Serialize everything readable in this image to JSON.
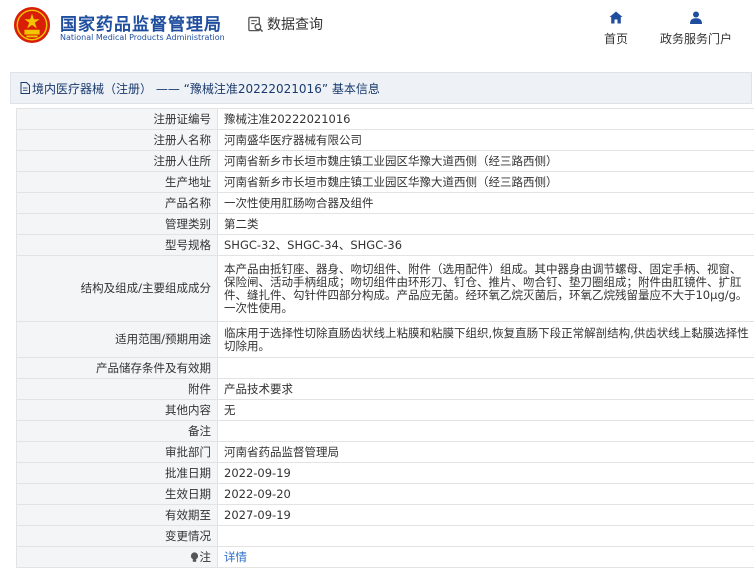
{
  "header": {
    "brand_cn": "国家药品监督管理局",
    "brand_en": "National Medical Products Administration",
    "query_label": "数据查询",
    "nav": [
      {
        "label": "首页",
        "icon": "home-icon"
      },
      {
        "label": "政务服务门户",
        "icon": "user-icon"
      }
    ]
  },
  "page": {
    "title": "境内医疗器械（注册） —— “豫械注准20222021016” 基本信息"
  },
  "rows": [
    {
      "label": "注册证编号",
      "value": "豫械注准20222021016"
    },
    {
      "label": "注册人名称",
      "value": "河南盛华医疗器械有限公司"
    },
    {
      "label": "注册人住所",
      "value": "河南省新乡市长垣市魏庄镇工业园区华豫大道西侧（经三路西侧）"
    },
    {
      "label": "生产地址",
      "value": "河南省新乡市长垣市魏庄镇工业园区华豫大道西侧（经三路西侧）"
    },
    {
      "label": "产品名称",
      "value": "一次性使用肛肠吻合器及组件"
    },
    {
      "label": "管理类别",
      "value": "第二类"
    },
    {
      "label": "型号规格",
      "value": "SHGC-32、SHGC-34、SHGC-36"
    },
    {
      "label": "结构及组成/主要组成成分",
      "value": "本产品由抵钉座、器身、吻切组件、附件（选用配件）组成。其中器身由调节螺母、固定手柄、视窗、保险闸、活动手柄组成；吻切组件由环形刀、钉仓、推片、吻合钉、垫刀圈组成；附件由肛镜件、扩肛件、缝扎件、勾针件四部分构成。产品应无菌。经环氧乙烷灭菌后，环氧乙烷残留量应不大于10μg/g。一次性使用。"
    },
    {
      "label": "适用范围/预期用途",
      "value": "临床用于选择性切除直肠齿状线上粘膜和粘膜下组织,恢复直肠下段正常解剖结构,供齿状线上黏膜选择性切除用。"
    },
    {
      "label": "产品储存条件及有效期",
      "value": ""
    },
    {
      "label": "附件",
      "value": "产品技术要求"
    },
    {
      "label": "其他内容",
      "value": "无"
    },
    {
      "label": "备注",
      "value": ""
    },
    {
      "label": "审批部门",
      "value": "河南省药品监督管理局"
    },
    {
      "label": "批准日期",
      "value": "2022-09-19"
    },
    {
      "label": "生效日期",
      "value": "2022-09-20"
    },
    {
      "label": "有效期至",
      "value": "2027-09-19"
    },
    {
      "label": "变更情况",
      "value": ""
    }
  ],
  "note_row": {
    "label": "注",
    "link": "详情",
    "icon": "lightbulb-icon"
  },
  "colors": {
    "brand": "#1f4e9f",
    "link": "#2b6cc4",
    "seal_red": "#d81e06",
    "seal_gold": "#f5c400"
  }
}
